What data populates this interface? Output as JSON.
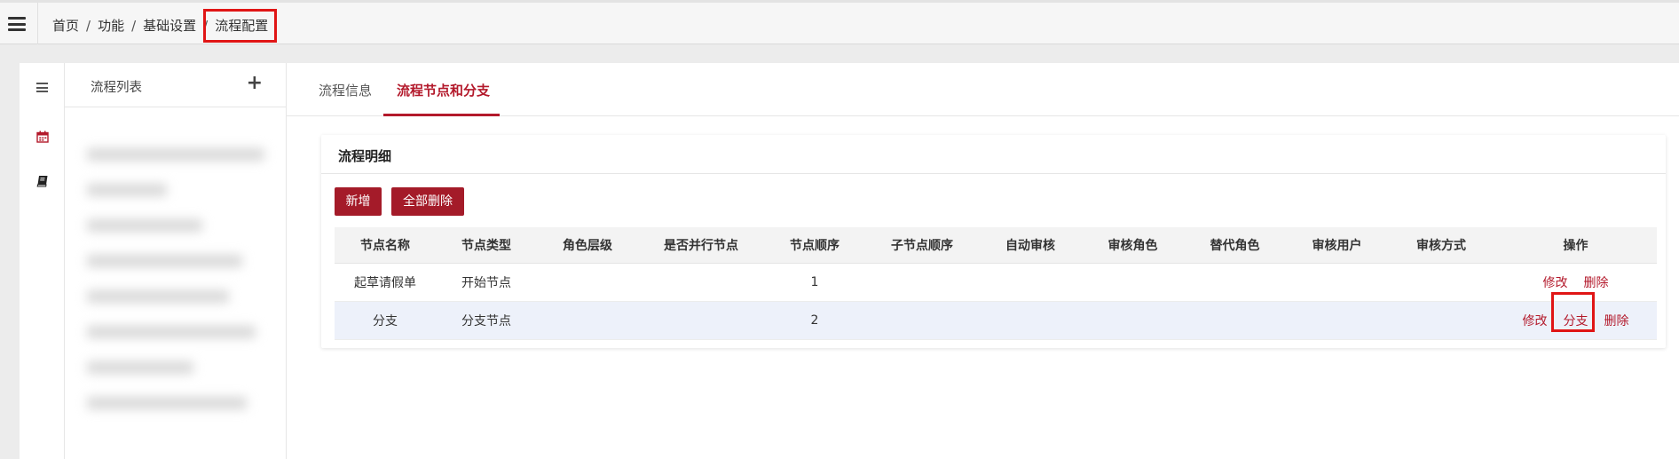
{
  "header": {
    "breadcrumb": [
      "首页",
      "功能",
      "基础设置",
      "流程配置"
    ],
    "separator": "/"
  },
  "sidebar": {
    "list_title": "流程列表",
    "add_symbol": "+"
  },
  "tabs": [
    {
      "label": "流程信息",
      "active": false
    },
    {
      "label": "流程节点和分支",
      "active": true
    }
  ],
  "panel": {
    "title": "流程明细",
    "add_button": "新增",
    "delete_all_button": "全部删除"
  },
  "table": {
    "columns": [
      "节点名称",
      "节点类型",
      "角色层级",
      "是否并行节点",
      "节点顺序",
      "子节点顺序",
      "自动审核",
      "审核角色",
      "替代角色",
      "审核用户",
      "审核方式",
      "操作"
    ],
    "rows": [
      {
        "cells": [
          "起草请假单",
          "开始节点",
          "",
          "",
          "1",
          "",
          "",
          "",
          "",
          "",
          ""
        ],
        "actions": [
          "修改",
          "删除"
        ]
      },
      {
        "cells": [
          "分支",
          "分支节点",
          "",
          "",
          "2",
          "",
          "",
          "",
          "",
          "",
          ""
        ],
        "actions": [
          "修改",
          "分支",
          "删除"
        ]
      }
    ]
  },
  "colors": {
    "accent": "#b3192b",
    "button_bg": "#a41b29",
    "highlight_box": "#e01515",
    "alt_row": "#edf1fa"
  }
}
